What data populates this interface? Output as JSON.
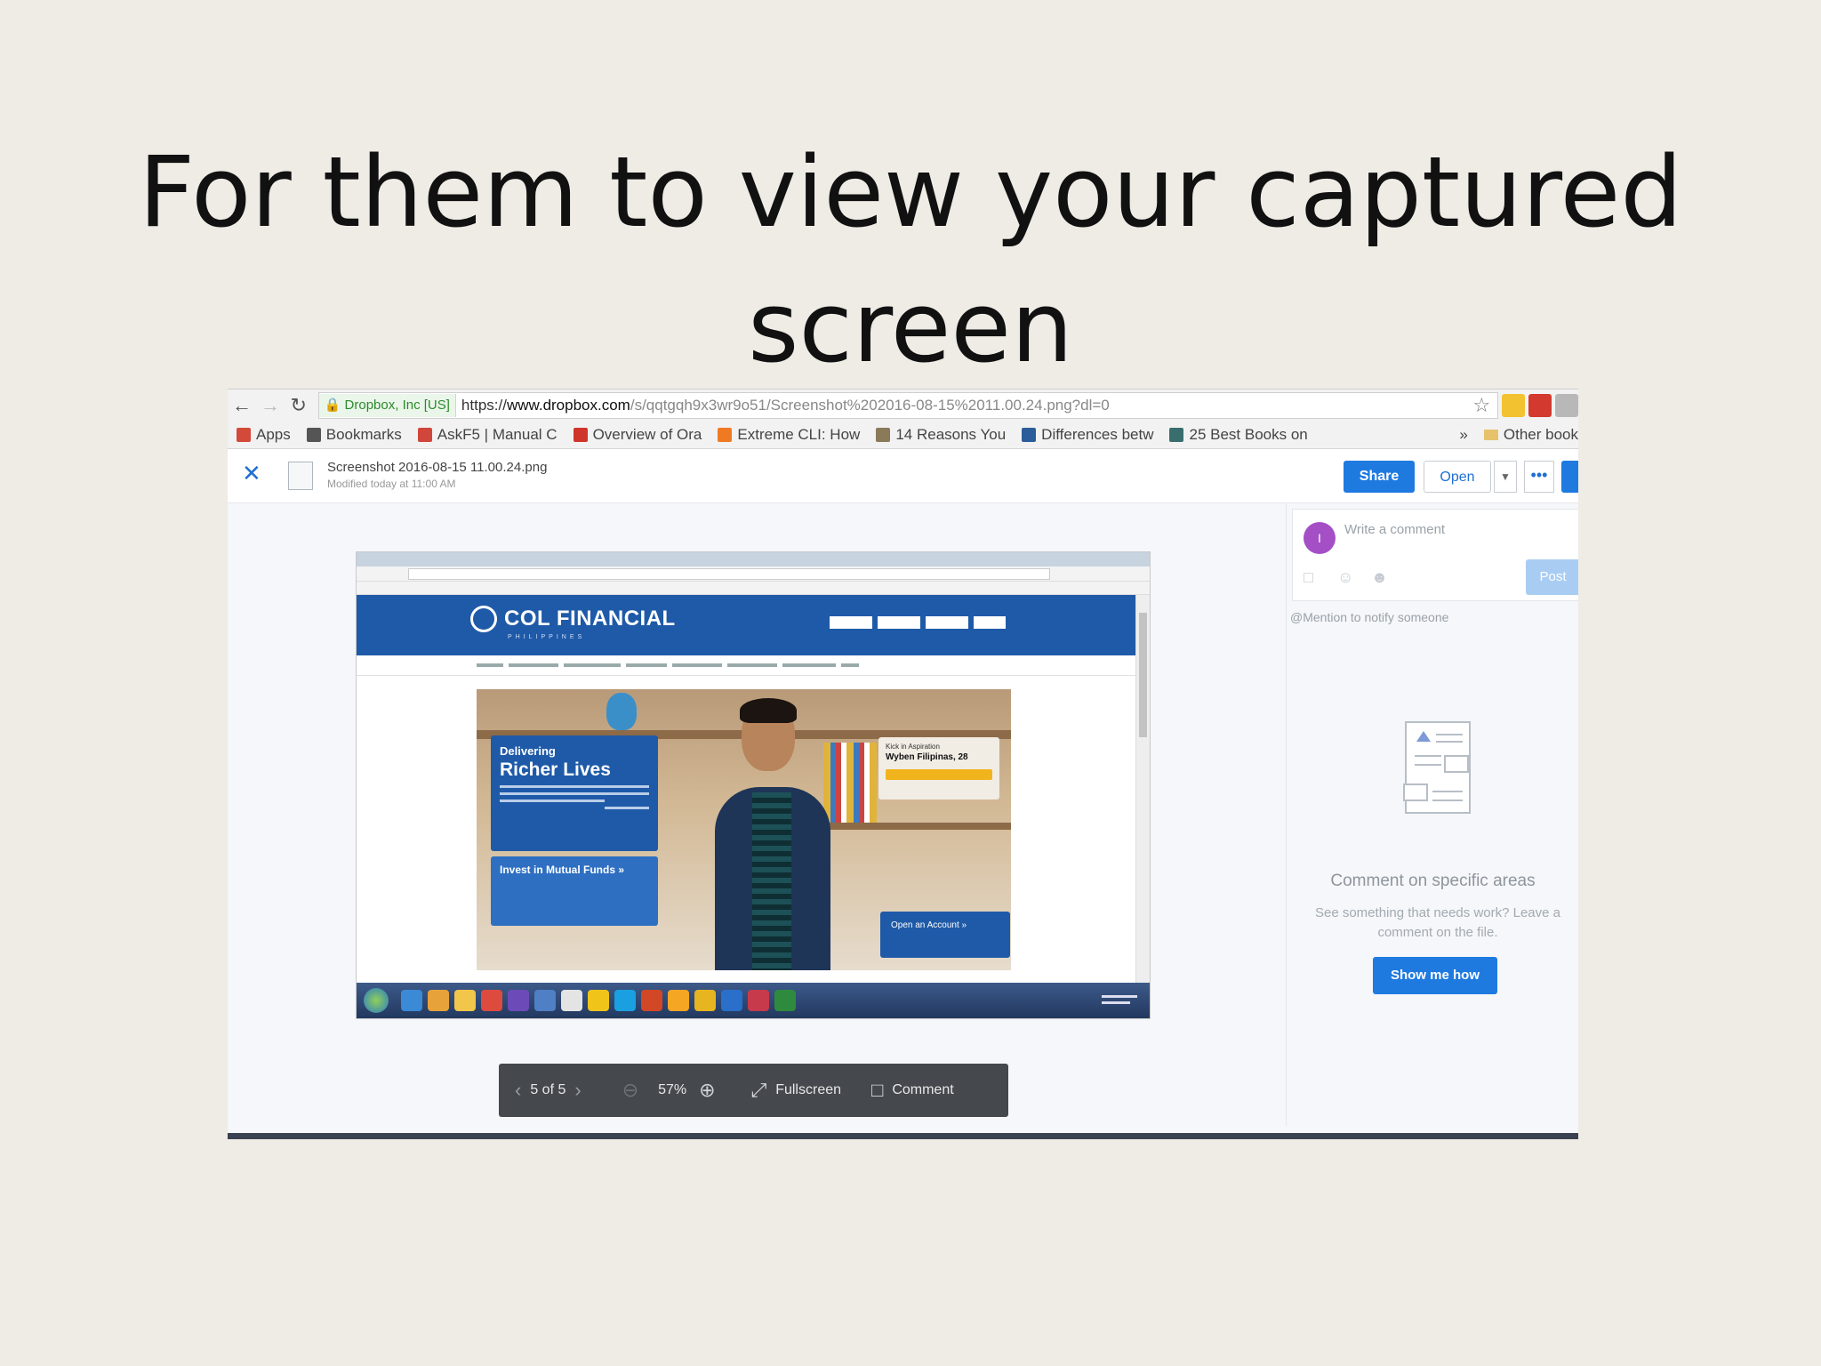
{
  "slide": {
    "title_line1": "For them to view your captured",
    "title_line2": "screen"
  },
  "browser": {
    "secure_label": "Dropbox, Inc [US]",
    "url_prefix": "https://",
    "url_host": "www.dropbox.com",
    "url_path": "/s/qqtgqh9x3wr9o51/Screenshot%202016-08-15%2011.00.24.png?dl=0",
    "bookmarks": [
      {
        "label": "Apps",
        "icon": "apps-grid-icon",
        "color": "#d34a3a"
      },
      {
        "label": "Bookmarks",
        "icon": "star-icon",
        "color": "#555555"
      },
      {
        "label": "AskF5 | Manual C",
        "icon": "f5-icon",
        "color": "#d0463b"
      },
      {
        "label": "Overview of Ora",
        "icon": "oracle-icon",
        "color": "#d0352b"
      },
      {
        "label": "Extreme CLI: How",
        "icon": "blogger-icon",
        "color": "#f07a22"
      },
      {
        "label": "14 Reasons You",
        "icon": "figure-icon",
        "color": "#8a7a5a"
      },
      {
        "label": "Differences betw",
        "icon": "chart-icon",
        "color": "#2b5d9a"
      },
      {
        "label": "25 Best Books on",
        "icon": "book-icon",
        "color": "#3a6e6e"
      }
    ],
    "bookmarks_overflow": "»",
    "other_bookmarks": "Other book"
  },
  "dropbox": {
    "file_name": "Screenshot 2016-08-15 11.00.24.png",
    "file_modified": "Modified today at 11:00 AM",
    "share_label": "Share",
    "open_label": "Open",
    "more_label": "•••",
    "accent": "#1f7ae0"
  },
  "inner_page": {
    "brand": "COL FINANCIAL",
    "brand_sub": "PHILIPPINES",
    "hero_kicker": "Delivering",
    "hero_headline": "Richer Lives",
    "mutual_funds": "Invest in Mutual Funds »",
    "kick_label": "Kick in Aspiration",
    "kick_name": "Wyben Filipinas, 28",
    "open_account": "Open an Account »",
    "brand_color": "#1f5aa8"
  },
  "viewer_toolbar": {
    "page_indicator": "5 of 5",
    "zoom": "57%",
    "fullscreen_label": "Fullscreen",
    "comment_label": "Comment"
  },
  "comments": {
    "avatar_initial": "I",
    "placeholder": "Write a comment",
    "post_label": "Post",
    "mention_hint": "@Mention to notify someone",
    "empty_title": "Comment on specific areas",
    "empty_desc": "See something that needs work? Leave a comment on the file.",
    "show_me_label": "Show me how"
  }
}
